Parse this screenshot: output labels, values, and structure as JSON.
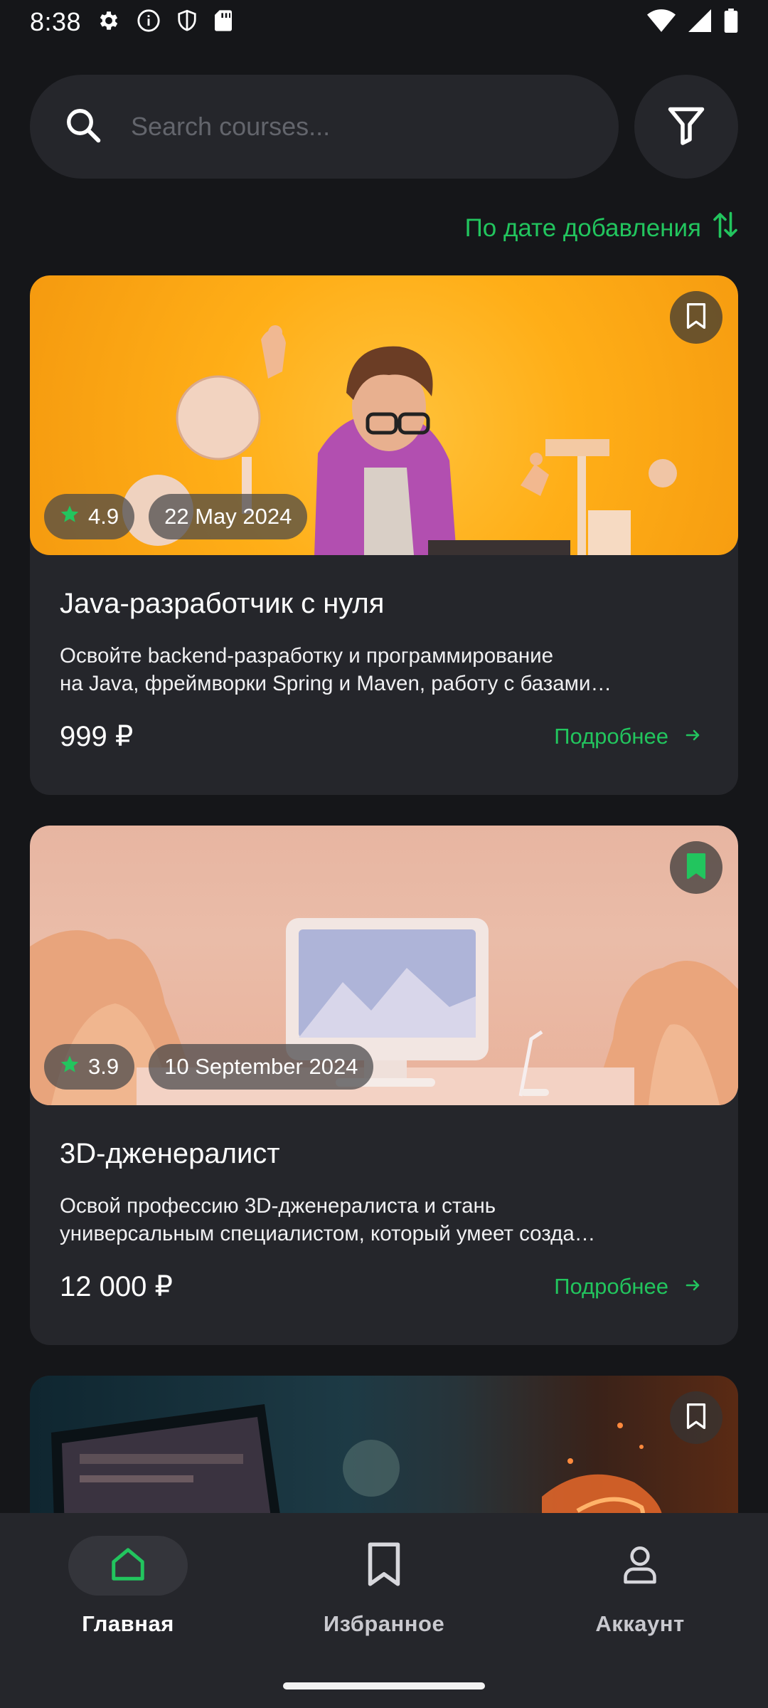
{
  "status_bar": {
    "time": "8:38"
  },
  "search": {
    "placeholder": "Search courses..."
  },
  "sort": {
    "label": "По дате добавления"
  },
  "courses": [
    {
      "title": "Java-разработчик с нуля",
      "description_line1": "Освойте backend-разработку и программирование",
      "description_line2": "на Java, фреймворки Spring и Maven, работу с базами…",
      "rating": "4.9",
      "date": "22 May 2024",
      "price": "999 ₽",
      "more_label": "Подробнее",
      "bookmarked": false
    },
    {
      "title": "3D-дженералист",
      "description_line1": "Освой профессию 3D-дженералиста и стань",
      "description_line2": "универсальным специалистом, который умеет созда…",
      "rating": "3.9",
      "date": "10 September 2024",
      "price": "12 000 ₽",
      "more_label": "Подробнее",
      "bookmarked": true
    },
    {
      "bookmarked": false
    }
  ],
  "bottom_nav": [
    {
      "label": "Главная",
      "icon": "home-icon",
      "active": true
    },
    {
      "label": "Избранное",
      "icon": "bookmark-icon",
      "active": false
    },
    {
      "label": "Аккаунт",
      "icon": "account-icon",
      "active": false
    }
  ],
  "colors": {
    "background": "#151619",
    "surface": "#25262b",
    "accent": "#22c55e",
    "text": "#ffffff"
  }
}
